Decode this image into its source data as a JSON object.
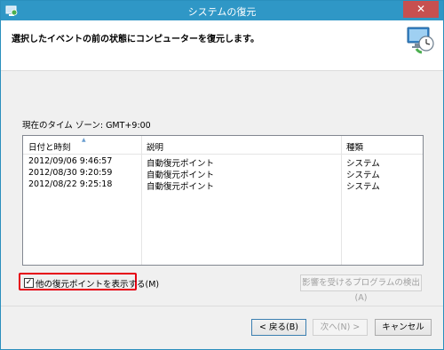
{
  "window": {
    "title": "システムの復元"
  },
  "header": {
    "heading": "選択したイベントの前の状態にコンピューターを復元します。"
  },
  "timezone_label": "現在のタイム ゾーン: GMT+9:00",
  "table": {
    "columns": [
      "日付と時刻",
      "説明",
      "種類"
    ],
    "rows": [
      [
        "2012/09/06 9:46:57",
        "自動復元ポイント",
        "システム"
      ],
      [
        "2012/08/30 9:20:59",
        "自動復元ポイント",
        "システム"
      ],
      [
        "2012/08/22 9:25:18",
        "自動復元ポイント",
        "システム"
      ]
    ]
  },
  "show_more_checkbox": {
    "label": "他の復元ポイントを表示する(M)",
    "checked": true
  },
  "buttons": {
    "scan": "影響を受けるプログラムの検出(A)",
    "back": "< 戻る(B)",
    "next": "次へ(N) >",
    "cancel": "キャンセル"
  },
  "colors": {
    "titlebar": "#2f97c6",
    "highlight_box": "#e60012",
    "close_button": "#c75050"
  },
  "icons": {
    "app": "system-restore-icon",
    "header": "system-restore-clock-icon",
    "close": "close-icon"
  }
}
